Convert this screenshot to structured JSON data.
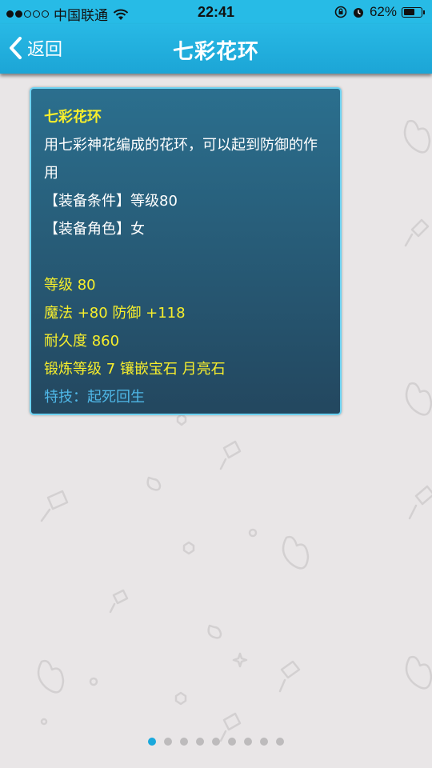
{
  "status_bar": {
    "carrier": "中国联通",
    "time": "22:41",
    "battery": "62%",
    "battery_level": 0.62,
    "signal_bars": 2
  },
  "nav": {
    "back_label": "返回",
    "title": "七彩花环"
  },
  "item": {
    "name": "七彩花环",
    "description": "用七彩神花编成的花环，可以起到防御的作用",
    "requirement": "【装备条件】等级80",
    "role": "【装备角色】女",
    "level": "等级 80",
    "stats": "魔法 +80 防御 +118",
    "durability": "耐久度 860",
    "forge": "锻炼等级 7 镶嵌宝石 月亮石",
    "skill": "特技：起死回生"
  },
  "pager": {
    "total": 9,
    "active_index": 0
  },
  "colors": {
    "nav": "#1ca5d6",
    "card": "#2b6f8e",
    "highlight": "#f7ee2c",
    "skill": "#4fb8e8"
  }
}
